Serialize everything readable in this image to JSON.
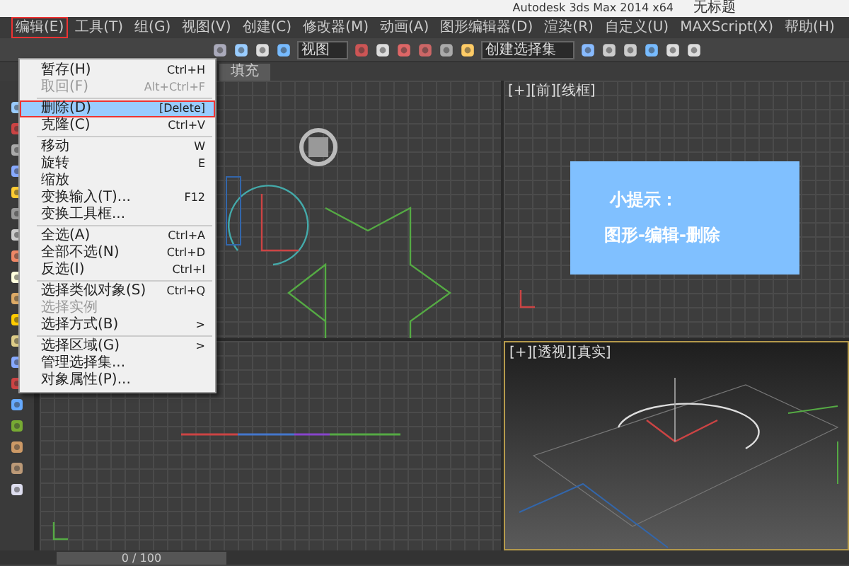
{
  "window": {
    "title": "Autodesk 3ds Max  2014 x64",
    "document": "无标题"
  },
  "menu_bar": [
    {
      "label": "编辑(E)",
      "selected": true
    },
    {
      "label": "工具(T)",
      "selected": false
    },
    {
      "label": "组(G)",
      "selected": false
    },
    {
      "label": "视图(V)",
      "selected": false
    },
    {
      "label": "创建(C)",
      "selected": false
    },
    {
      "label": "修改器(M)",
      "selected": false
    },
    {
      "label": "动画(A)",
      "selected": false
    },
    {
      "label": "图形编辑器(D)",
      "selected": false
    },
    {
      "label": "渲染(R)",
      "selected": false
    },
    {
      "label": "自定义(U)",
      "selected": false
    },
    {
      "label": "MAXScript(X)",
      "selected": false
    },
    {
      "label": "帮助(H)",
      "selected": false
    }
  ],
  "toolbar": {
    "view_dropdown": "视图",
    "selection_set_dropdown": "创建选择集"
  },
  "ribbon_tabs": [
    {
      "label": "填充",
      "selected": true
    }
  ],
  "edit_menu": [
    {
      "kind": "item",
      "label": "暂存(H)",
      "shortcut": "Ctrl+H",
      "disabled": false,
      "selected": false
    },
    {
      "kind": "item",
      "label": "取回(F)",
      "shortcut": "Alt+Ctrl+F",
      "disabled": true,
      "selected": false
    },
    {
      "kind": "separator"
    },
    {
      "kind": "item",
      "label": "删除(D)",
      "shortcut": "[Delete]",
      "disabled": false,
      "selected": true
    },
    {
      "kind": "item",
      "label": "克隆(C)",
      "shortcut": "Ctrl+V",
      "disabled": false,
      "selected": false
    },
    {
      "kind": "separator"
    },
    {
      "kind": "item",
      "label": "移动",
      "shortcut": "W",
      "disabled": false,
      "selected": false
    },
    {
      "kind": "item",
      "label": "旋转",
      "shortcut": "E",
      "disabled": false,
      "selected": false
    },
    {
      "kind": "item",
      "label": "缩放",
      "disabled": false,
      "selected": false
    },
    {
      "kind": "item",
      "label": "变换输入(T)...",
      "shortcut": "F12",
      "disabled": false,
      "selected": false
    },
    {
      "kind": "item",
      "label": "变换工具框...",
      "disabled": false,
      "selected": false
    },
    {
      "kind": "separator"
    },
    {
      "kind": "item",
      "label": "全选(A)",
      "shortcut": "Ctrl+A",
      "disabled": false,
      "selected": false
    },
    {
      "kind": "item",
      "label": "全部不选(N)",
      "shortcut": "Ctrl+D",
      "disabled": false,
      "selected": false
    },
    {
      "kind": "item",
      "label": "反选(I)",
      "shortcut": "Ctrl+I",
      "disabled": false,
      "selected": false
    },
    {
      "kind": "separator"
    },
    {
      "kind": "item",
      "label": "选择类似对象(S)",
      "shortcut": "Ctrl+Q",
      "disabled": false,
      "selected": false
    },
    {
      "kind": "item",
      "label": "选择实例",
      "disabled": true,
      "selected": false
    },
    {
      "kind": "item",
      "label": "选择方式(B)",
      "shortcut": ">",
      "disabled": false,
      "selected": false
    },
    {
      "kind": "separator"
    },
    {
      "kind": "item",
      "label": "选择区域(G)",
      "shortcut": ">",
      "disabled": false,
      "selected": false
    },
    {
      "kind": "item",
      "label": "管理选择集...",
      "disabled": false,
      "selected": false
    },
    {
      "kind": "item",
      "label": "对象属性(P)...",
      "disabled": false,
      "selected": false
    }
  ],
  "viewports": [
    {
      "label": "[+][前][线框]"
    },
    {
      "label": "[+][透视][真实]"
    }
  ],
  "tip": {
    "title": "小提示：",
    "text": "图形-编辑-删除"
  },
  "timeline": {
    "frame": "0 / 100"
  }
}
